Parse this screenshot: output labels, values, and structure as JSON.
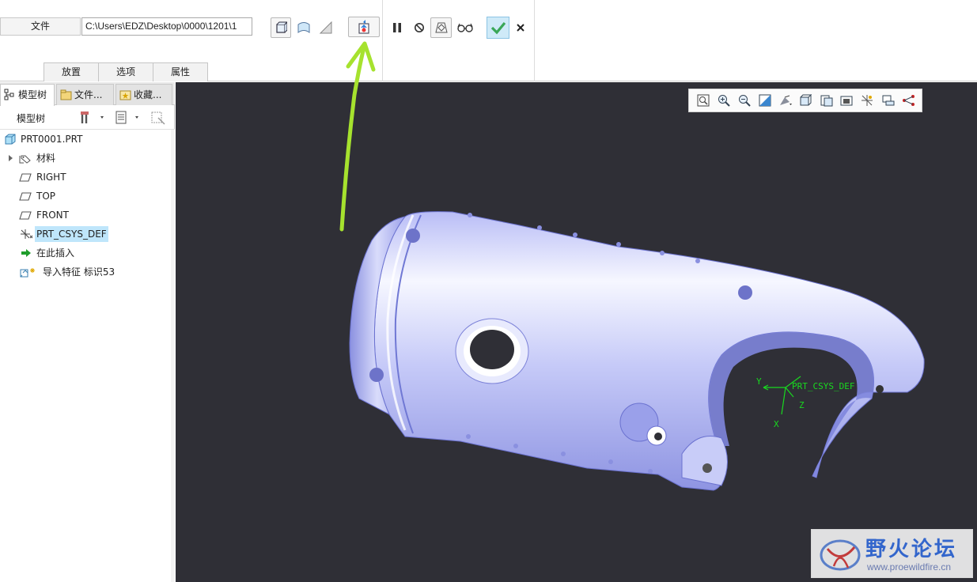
{
  "ribbon": {
    "file_label": "文件",
    "file_path": "C:\\Users\\EDZ\\Desktop\\0000\\1201\\1",
    "tabs": [
      {
        "label": "放置"
      },
      {
        "label": "选项"
      },
      {
        "label": "属性"
      }
    ],
    "icons": [
      "solid-body-icon",
      "surface-icon",
      "remove-material-icon",
      "import-feature-icon",
      "pause-icon",
      "no-preview-icon",
      "verify-preview-icon",
      "preview-glasses-icon",
      "confirm-check-icon",
      "cancel-x-icon"
    ],
    "confirm_color": "#3aa757"
  },
  "panel": {
    "tabs": [
      {
        "label": "模型树",
        "icon": "model-tree-icon"
      },
      {
        "label": "文件...",
        "icon": "folder-browser-icon"
      },
      {
        "label": "收藏...",
        "icon": "favorites-icon"
      }
    ],
    "tree_title": "模型树",
    "tree": [
      {
        "label": "PRT0001.PRT",
        "icon": "part-icon"
      },
      {
        "label": "材料",
        "icon": "material-icon"
      },
      {
        "label": "RIGHT",
        "icon": "datum-plane-icon"
      },
      {
        "label": "TOP",
        "icon": "datum-plane-icon"
      },
      {
        "label": "FRONT",
        "icon": "datum-plane-icon"
      },
      {
        "label": "PRT_CSYS_DEF",
        "icon": "csys-icon"
      },
      {
        "label": "在此插入",
        "icon": "insert-here-icon"
      },
      {
        "label": "导入特征 标识53",
        "icon": "import-feature-icon"
      }
    ]
  },
  "viewport": {
    "background": "#2f2f36",
    "model_color": "#a5aaf0",
    "csys_label": "PRT_CSYS_DEF",
    "axes": {
      "x": "X",
      "y": "Y",
      "z": "Z"
    },
    "view_toolbar_icons": [
      "refit-icon",
      "zoom-in-icon",
      "zoom-out-icon",
      "repaint-icon",
      "display-style-icon",
      "saved-orientations-icon",
      "named-views-icon",
      "view-manager-icon",
      "datum-display-icon",
      "spin-center-icon",
      "annotation-display-icon"
    ],
    "watermark": {
      "title": "野火论坛",
      "url": "www.proewildfire.cn"
    }
  },
  "annotation": {
    "color": "#a6e22e"
  }
}
